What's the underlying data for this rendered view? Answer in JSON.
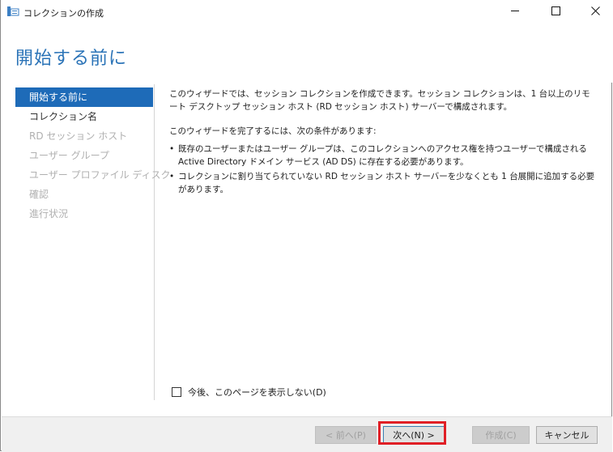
{
  "window": {
    "title": "コレクションの作成"
  },
  "header": {
    "title": "開始する前に"
  },
  "nav": {
    "items": [
      {
        "label": "開始する前に",
        "state": "active"
      },
      {
        "label": "コレクション名",
        "state": "enabled"
      },
      {
        "label": "RD セッション ホスト",
        "state": "disabled"
      },
      {
        "label": "ユーザー グループ",
        "state": "disabled"
      },
      {
        "label": "ユーザー プロファイル ディスク",
        "state": "disabled"
      },
      {
        "label": "確認",
        "state": "disabled"
      },
      {
        "label": "進行状況",
        "state": "disabled"
      }
    ]
  },
  "content": {
    "intro": "このウィザードでは、セッション コレクションを作成できます。セッション コレクションは、1 台以上のリモート デスクトップ セッション ホスト (RD セッション ホスト) サーバーで構成されます。",
    "conditions_heading": "このウィザードを完了するには、次の条件があります:",
    "bullets": [
      "既存のユーザーまたはユーザー グループは、このコレクションへのアクセス権を持つユーザーで構成される Active Directory ドメイン サービス (AD DS) に存在する必要があります。",
      "コレクションに割り当てられていない RD セッション ホスト サーバーを少なくとも 1 台展開に追加する必要があります。"
    ]
  },
  "dont_show": {
    "label": "今後、このページを表示しない(D)",
    "checked": false
  },
  "footer": {
    "prev_label": "< 前へ(P)",
    "next_label": "次へ(N) >",
    "create_label": "作成(C)",
    "cancel_label": "キャンセル"
  },
  "colors": {
    "accent": "#1e6bb8",
    "title": "#2a73b7",
    "highlight": "#e01f26"
  },
  "icons": {
    "app": "server-wizard-icon",
    "minimize": "minimize-icon",
    "maximize": "maximize-icon",
    "close": "close-icon"
  }
}
